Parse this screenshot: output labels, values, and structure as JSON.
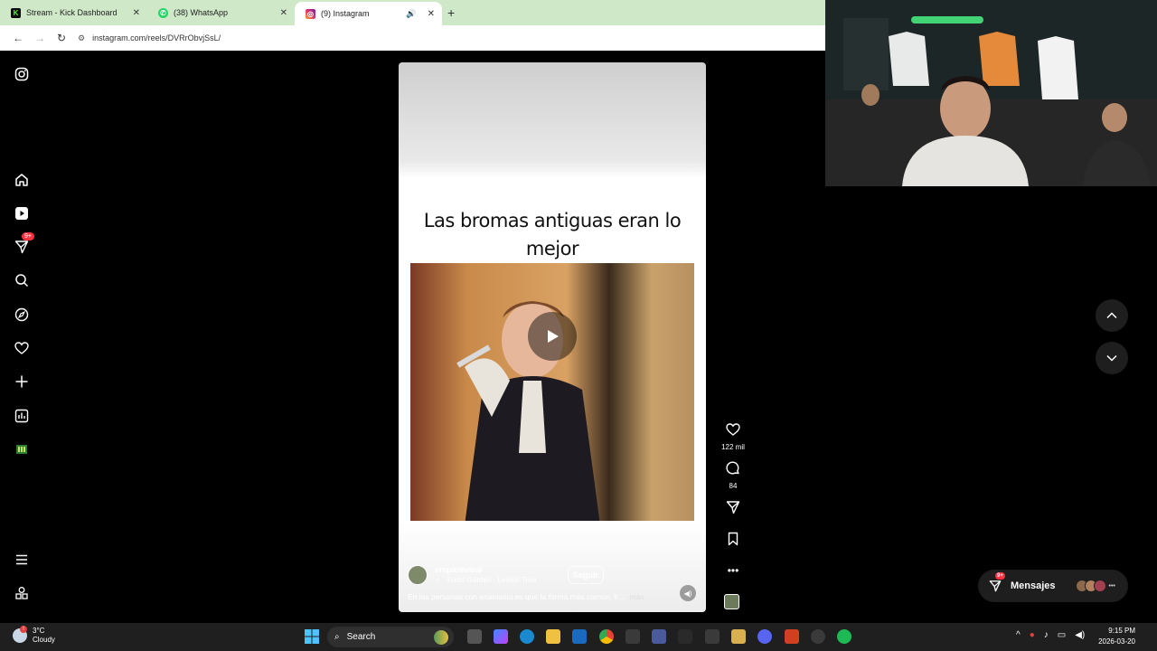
{
  "browser": {
    "tabs": [
      {
        "title": "Stream - Kick Dashboard",
        "favicon": "kick-icon",
        "color": "#53fc18",
        "active": false
      },
      {
        "title": "(38) WhatsApp",
        "favicon": "whatsapp-icon",
        "color": "#25d366",
        "active": false
      },
      {
        "title": "(9) Instagram",
        "favicon": "instagram-icon",
        "color": "#e1306c",
        "active": true
      }
    ],
    "url": "instagram.com/reels/DVRrObvjSsL/"
  },
  "instagram": {
    "nav": {
      "notifications_badge": "9+"
    },
    "reel": {
      "caption": "Las bromas antiguas eran lo mejor",
      "username": "empiemviral",
      "music": "Fools Garden · Lemon Tree",
      "follow_label": "Seguir",
      "description": "En las personas con enanismo es que la forma más común, ll ...",
      "more_label": "más"
    },
    "actions": {
      "likes": "122 mil",
      "comments": "84"
    },
    "messages": {
      "label": "Mensajes",
      "badge": "9+"
    }
  },
  "taskbar": {
    "weather_temp": "3°C",
    "weather_desc": "Cloudy",
    "search_placeholder": "Search",
    "time": "9:15 PM",
    "date": "2026-03-20"
  },
  "colors": {
    "accent_badge": "#ff3040",
    "tabbar_bg": "#cfe8c8"
  }
}
